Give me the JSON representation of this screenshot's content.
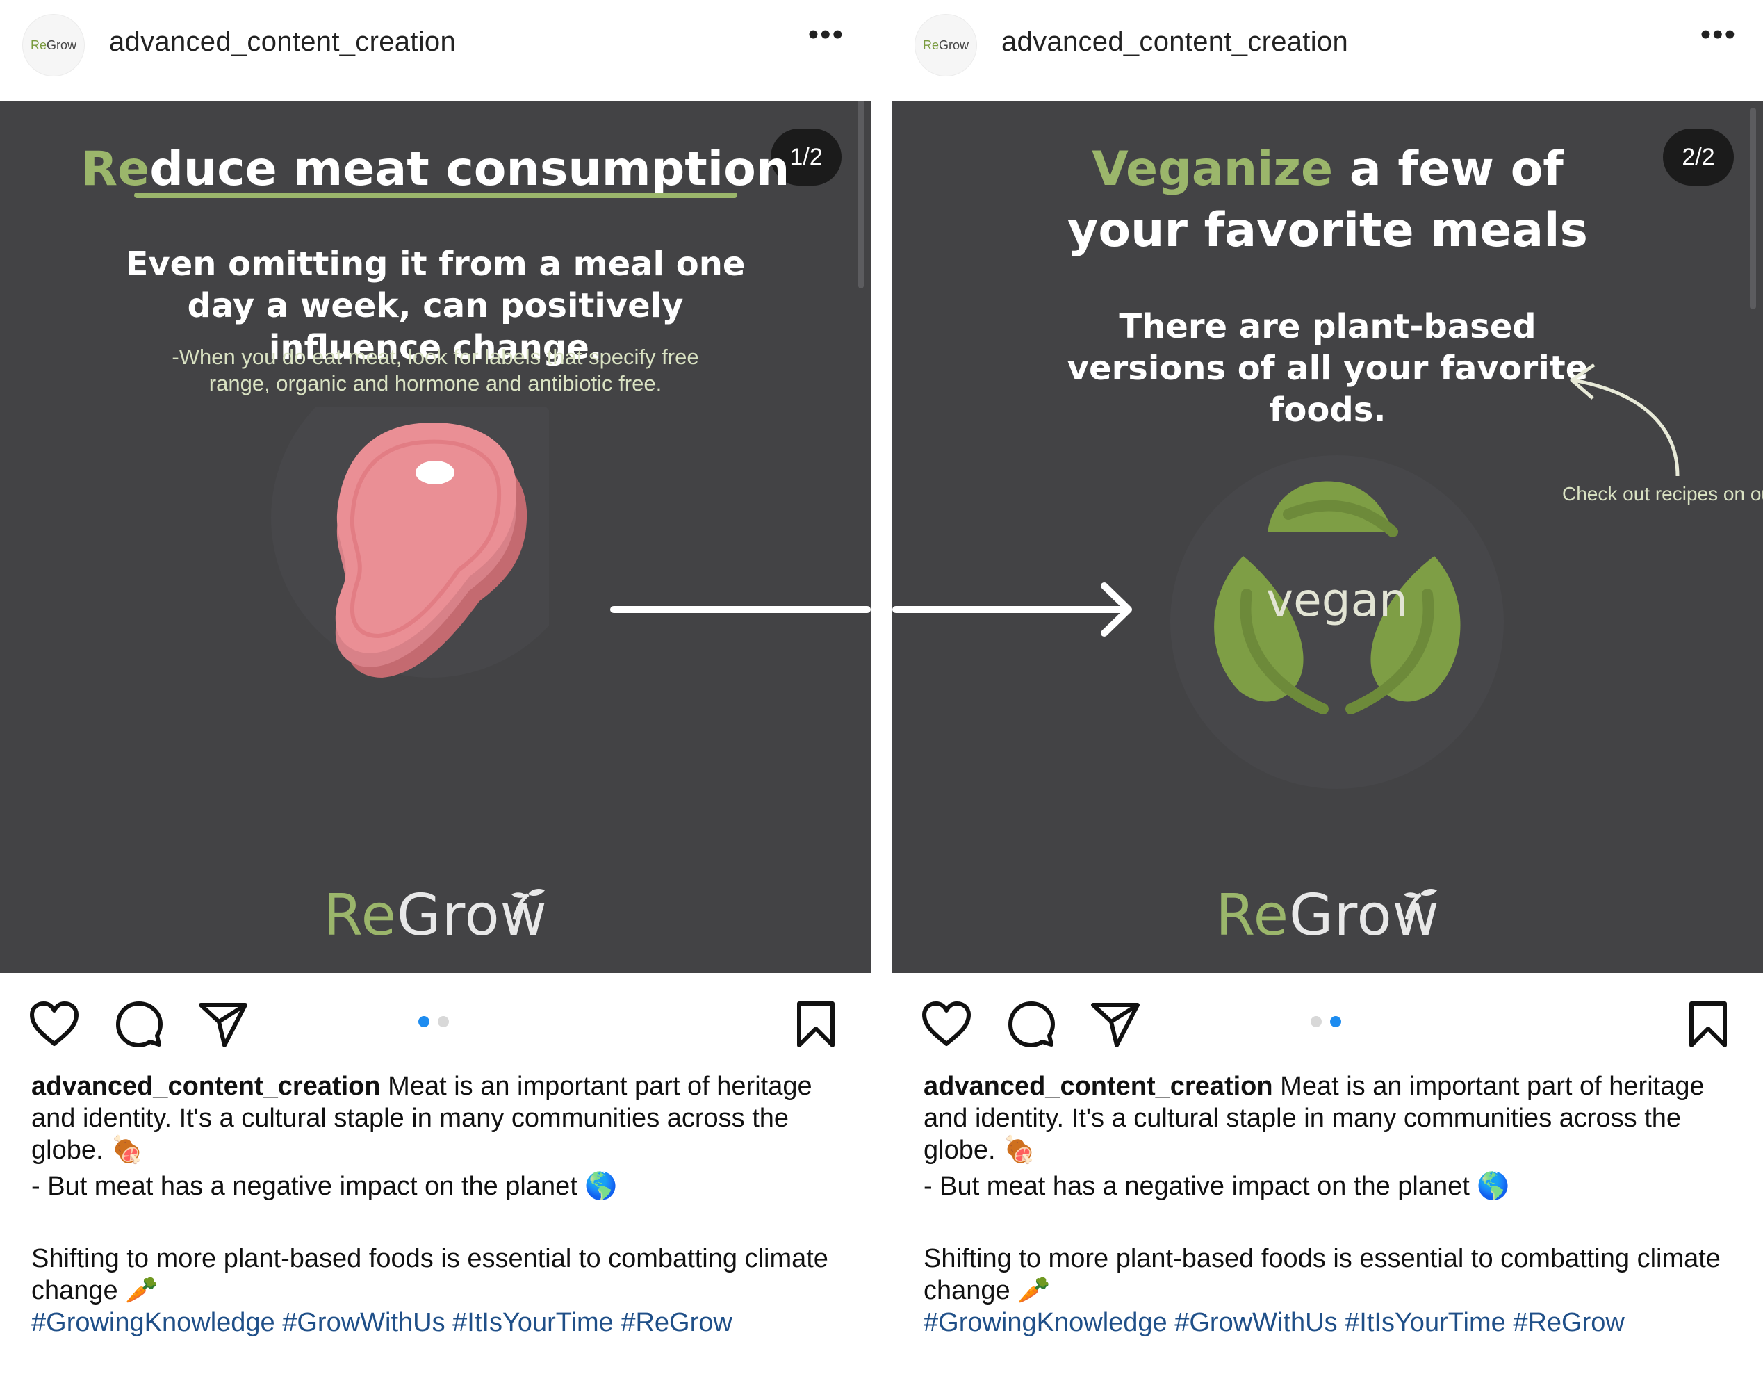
{
  "colors": {
    "accent_green": "#9bb66b",
    "media_bg": "#434345",
    "dot_active": "#1d8cf0",
    "hashtag": "#1f4f88"
  },
  "avatar_text": {
    "re": "Re",
    "grow": "Grow"
  },
  "posts": [
    {
      "username": "advanced_content_creation",
      "counter": "1/2",
      "headline_accent": "Re",
      "headline_rest": "duce meat consumption",
      "sub": "Even omitting it from a meal one day a week, can positively influence change.",
      "note": "-When you do eat meat, look for labels that specify free range, organic and hormone and antibiotic free.",
      "logo_re": "Re",
      "logo_grow": "Grow",
      "active_dot": 0
    },
    {
      "username": "advanced_content_creation",
      "counter": "2/2",
      "headline_accent": "Veganize",
      "headline_rest": " a few of your favorite meals",
      "sub": "There are plant-based versions of all your favorite foods.",
      "annotation": "Check out recipes on our blog",
      "vegan_label": "vegan",
      "logo_re": "Re",
      "logo_grow": "Grow",
      "active_dot": 1
    }
  ],
  "caption": {
    "username": "advanced_content_creation",
    "line1": " Meat is an important part of heritage and identity. It's a cultural staple in many communities across the globe. 🍖",
    "line2": "- But meat has a negative impact on the planet 🌎",
    "line3": "Shifting to more plant-based foods is essential to combatting climate change 🥕",
    "hashtags": "#GrowingKnowledge #GrowWithUs #ItIsYourTime #ReGrow"
  },
  "icons": [
    "heart-icon",
    "comment-icon",
    "share-icon",
    "bookmark-icon",
    "more-options-icon"
  ]
}
